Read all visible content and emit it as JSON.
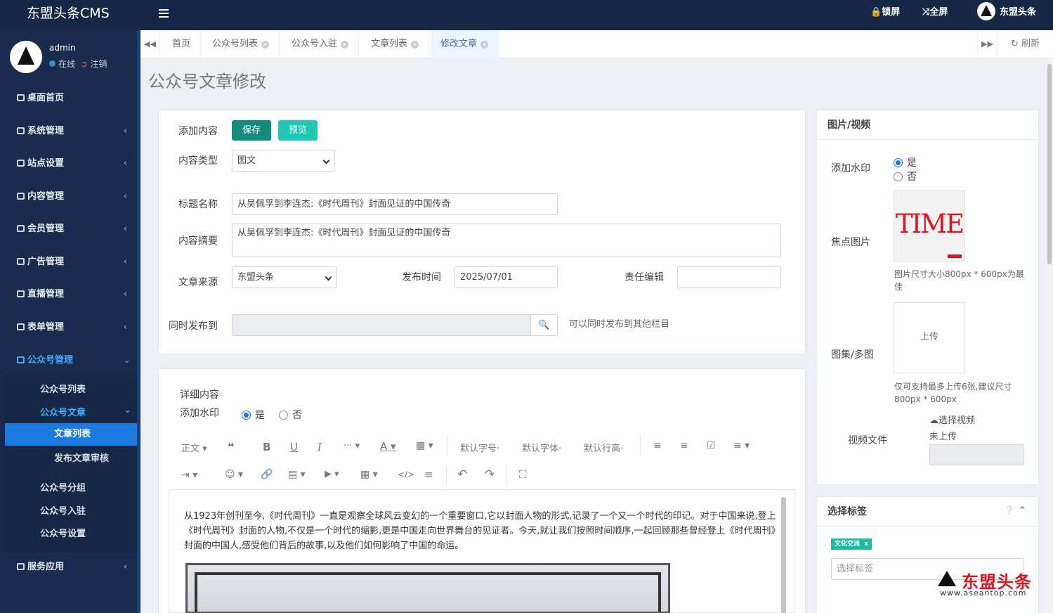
{
  "app": {
    "title": "东盟头条CMS",
    "lock": "锁屏",
    "fullscreen": "全屏",
    "user_brand": "东盟头条"
  },
  "user": {
    "name": "admin",
    "status": "在线",
    "logout": "注销"
  },
  "sidebar": {
    "items": [
      {
        "label": "桌面首页"
      },
      {
        "label": "系统管理"
      },
      {
        "label": "站点设置"
      },
      {
        "label": "内容管理"
      },
      {
        "label": "会员管理"
      },
      {
        "label": "广告管理"
      },
      {
        "label": "直播管理"
      },
      {
        "label": "表单管理"
      },
      {
        "label": "公众号管理"
      },
      {
        "label": "服务应用"
      }
    ],
    "sub": [
      "公众号列表",
      "公众号文章",
      "文章列表",
      "发布文章审核",
      "公众号分组",
      "公众号入驻",
      "公众号设置"
    ]
  },
  "tabs": [
    "首页",
    "公众号列表",
    "公众号入驻",
    "文章列表",
    "修改文章"
  ],
  "tabs_refresh": "刷新",
  "page_title": "公众号文章修改",
  "form": {
    "add_content": "添加内容",
    "save": "保存",
    "preview": "预览",
    "content_type_label": "内容类型",
    "content_type_value": "图文",
    "title_label": "标题名称",
    "title_value": "从吴佩孚到李连杰:《时代周刊》封面见证的中国传奇",
    "summary_label": "内容摘要",
    "summary_value": "从吴佩孚到李连杰:《时代周刊》封面见证的中国传奇",
    "source_label": "文章来源",
    "source_value": "东盟头条",
    "time_label": "发布时间",
    "time_value": "2025/07/01",
    "editor_label": "责任编辑",
    "editor_value": "",
    "publish_to_label": "同时发布到",
    "publish_to_hint": "可以同时发布到其他栏目"
  },
  "detail": {
    "label": "详细内容",
    "watermark_label": "添加水印",
    "yes": "是",
    "no": "否",
    "toolbar": {
      "paragraph": "正文",
      "font_size": "默认字号",
      "font_family": "默认字体",
      "line_height": "默认行高"
    },
    "body_text": "从1923年创刊至今,《时代周刊》一直是观察全球风云变幻的一个重要窗口,它以封面人物的形式,记录了一个又一个时代的印记。对于中国来说,登上《时代周刊》封面的人物,不仅是一个时代的缩影,更是中国走向世界舞台的见证者。今天,就让我们按照时间顺序,一起回顾那些曾经登上《时代周刊》封面的中国人,感受他们背后的故事,以及他们如何影响了中国的命运。"
  },
  "media": {
    "header": "图片/视频",
    "watermark_label": "添加水印",
    "yes": "是",
    "no": "否",
    "focus_label": "焦点图片",
    "focus_image_text": "TIME",
    "focus_hint": "图片尺寸大小800px * 600px为最佳",
    "gallery_label": "图集/多图",
    "upload": "上传",
    "gallery_hint": "仅可支持最多上传6张,建议尺寸800px * 600px",
    "video_label": "视频文件",
    "choose_video": "选择视频",
    "not_uploaded": "未上传"
  },
  "tags": {
    "header": "选择标签",
    "tag": "文化交流",
    "placeholder": "选择标签"
  },
  "watermark": {
    "brand": "东盟头条",
    "url": "www.aseantop.com"
  }
}
